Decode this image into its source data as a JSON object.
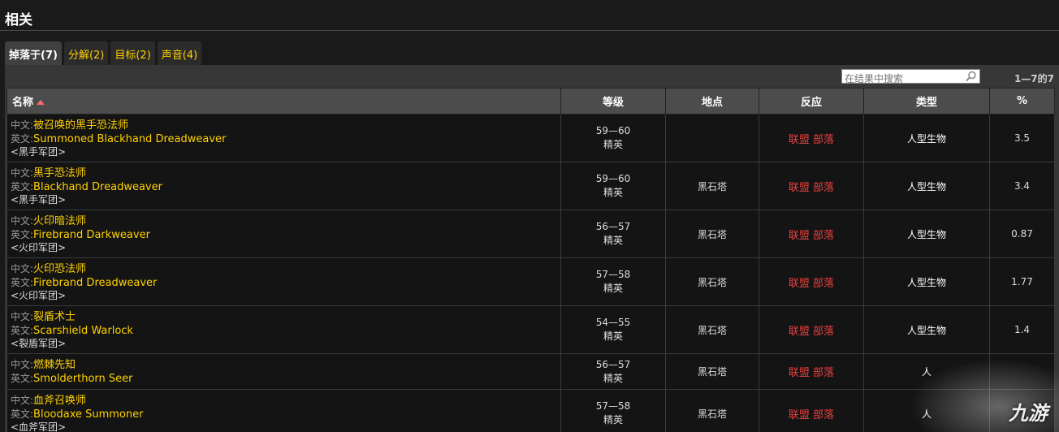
{
  "header": {
    "title": "相关"
  },
  "tabs": [
    {
      "label": "掉落于(7)",
      "active": true
    },
    {
      "label": "分解(2)",
      "active": false
    },
    {
      "label": "目标(2)",
      "active": false
    },
    {
      "label": "声音(4)",
      "active": false
    }
  ],
  "search": {
    "placeholder": "在结果中搜索"
  },
  "pager": "1—7的7",
  "columns": {
    "name": "名称",
    "level": "等级",
    "location": "地点",
    "react": "反应",
    "type": "类型",
    "pct": "%"
  },
  "labels": {
    "cn": "中文:",
    "en": "英文:"
  },
  "rows": [
    {
      "cn": "被召唤的黑手恐法师",
      "en": "Summoned Blackhand Dreadweaver",
      "tag": "<黑手军团>",
      "level": "59—60",
      "rank": "精英",
      "location": "",
      "react": "联盟 部落",
      "type": "人型生物",
      "pct": "3.5"
    },
    {
      "cn": "黑手恐法师",
      "en": "Blackhand Dreadweaver",
      "tag": "<黑手军团>",
      "level": "59—60",
      "rank": "精英",
      "location": "黑石塔",
      "react": "联盟 部落",
      "type": "人型生物",
      "pct": "3.4"
    },
    {
      "cn": "火印暗法师",
      "en": "Firebrand Darkweaver",
      "tag": "<火印军团>",
      "level": "56—57",
      "rank": "精英",
      "location": "黑石塔",
      "react": "联盟 部落",
      "type": "人型生物",
      "pct": "0.87"
    },
    {
      "cn": "火印恐法师",
      "en": "Firebrand Dreadweaver",
      "tag": "<火印军团>",
      "level": "57—58",
      "rank": "精英",
      "location": "黑石塔",
      "react": "联盟 部落",
      "type": "人型生物",
      "pct": "1.77"
    },
    {
      "cn": "裂盾术士",
      "en": "Scarshield Warlock",
      "tag": "<裂盾军团>",
      "level": "54—55",
      "rank": "精英",
      "location": "黑石塔",
      "react": "联盟 部落",
      "type": "人型生物",
      "pct": "1.4"
    },
    {
      "cn": "燃棘先知",
      "en": "Smolderthorn Seer",
      "tag": "",
      "level": "56—57",
      "rank": "精英",
      "location": "黑石塔",
      "react": "联盟 部落",
      "type": "人",
      "pct": ""
    },
    {
      "cn": "血斧召唤师",
      "en": "Bloodaxe Summoner",
      "tag": "<血斧军团>",
      "level": "57—58",
      "rank": "精英",
      "location": "黑石塔",
      "react": "联盟 部落",
      "type": "人",
      "pct": ""
    }
  ],
  "watermark": "九游"
}
